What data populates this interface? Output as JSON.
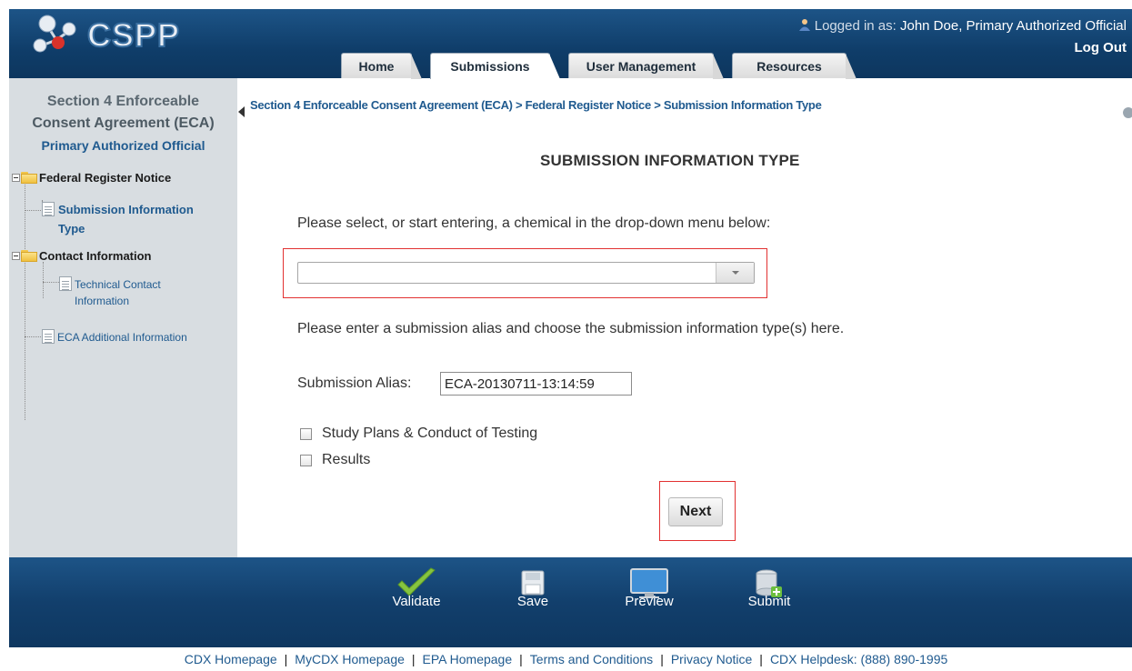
{
  "app": {
    "logo_text": "CSPP"
  },
  "header": {
    "login_prefix": "Logged in as:",
    "login_name": "John Doe, Primary Authorized Official",
    "logout": "Log Out"
  },
  "tabs": [
    {
      "label": "Home",
      "active": false
    },
    {
      "label": "Submissions",
      "active": true
    },
    {
      "label": "User Management",
      "active": false
    },
    {
      "label": "Resources",
      "active": false
    }
  ],
  "sidebar": {
    "title_line1": "Section 4 Enforceable",
    "title_line2": "Consent Agreement (ECA)",
    "role": "Primary Authorized Official",
    "tree": {
      "root": "Federal Register Notice",
      "item1_line1": "Submission Information",
      "item1_line2": "Type",
      "folder2": "Contact Information",
      "item2_line1": "Technical Contact",
      "item2_line2": "Information",
      "item3": "ECA Additional Information"
    }
  },
  "main": {
    "breadcrumb": "Section 4 Enforceable Consent Agreement (ECA) > Federal Register Notice > Submission Information Type",
    "title": "SUBMISSION INFORMATION TYPE",
    "prompt_chemical": "Please select, or start entering, a chemical in the drop-down menu below:",
    "chemical_value": "",
    "prompt_alias": "Please enter a submission alias and choose the submission information type(s) here.",
    "alias_label": "Submission Alias:",
    "alias_value": "ECA-20130711-13:14:59",
    "checkboxes": [
      {
        "label": "Study Plans & Conduct of Testing",
        "checked": false
      },
      {
        "label": "Results",
        "checked": false
      }
    ],
    "next_button": "Next"
  },
  "toolbar": {
    "validate": "Validate",
    "save": "Save",
    "preview": "Preview",
    "submit": "Submit"
  },
  "footer_links": {
    "cdx_home": "CDX Homepage",
    "mycdx_home": "MyCDX Homepage",
    "epa_home": "EPA Homepage",
    "terms": "Terms and Conditions",
    "privacy": "Privacy Notice",
    "helpdesk": "CDX Helpdesk: (888) 890-1995"
  },
  "colors": {
    "header_blue": "#0f3d69",
    "link_blue": "#1f5a8f",
    "highlight_red": "#e23131",
    "sidebar_bg": "#d8dde1"
  }
}
